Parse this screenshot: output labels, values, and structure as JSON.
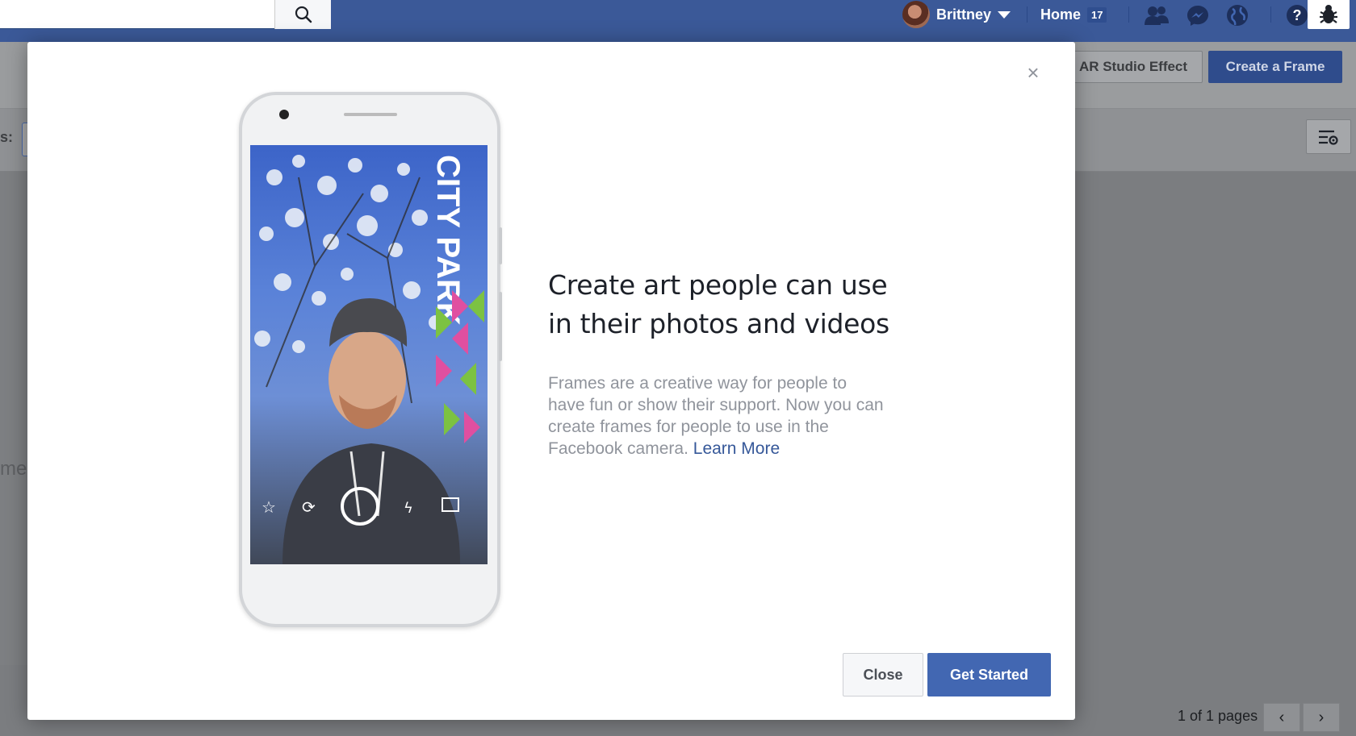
{
  "topbar": {
    "user_name": "Brittney",
    "home_label": "Home",
    "home_count": "17"
  },
  "page": {
    "ar_button": "AR Studio Effect",
    "create_frame_button": "Create a Frame",
    "left_label_s": "s:",
    "left_label_me": "me",
    "pager_text": "1 of 1 pages"
  },
  "modal": {
    "close_x": "×",
    "heading": "Create art people can use in their photos and videos",
    "body": "Frames are a creative way for people to have fun or show their support. Now you can create frames for people to use in the Facebook camera.",
    "learn_more": "Learn More",
    "close_button": "Close",
    "start_button": "Get Started",
    "phone_frame_text": "CITY PARK"
  },
  "colors": {
    "brand": "#4267b2",
    "link": "#365899"
  }
}
